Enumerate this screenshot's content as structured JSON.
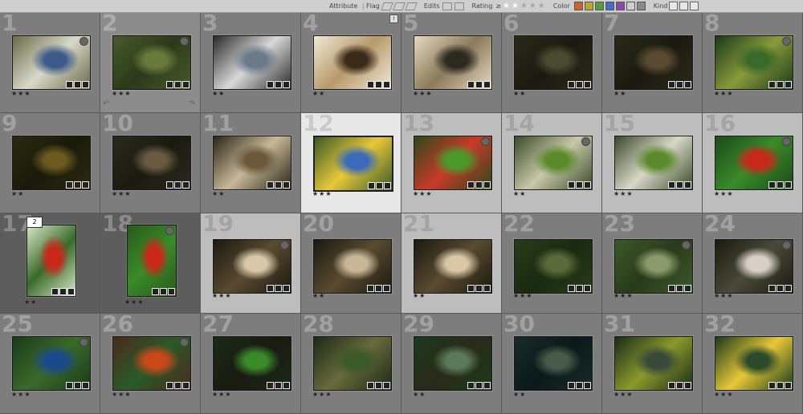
{
  "filter_bar": {
    "attribute_label": "Attribute",
    "flag_label": "Flag",
    "edits_label": "Edits",
    "rating_label": "Rating",
    "color_label": "Color",
    "kind_label": "Kind",
    "rating_compare": "≥",
    "color_swatches": [
      "#c86432",
      "#b8a830",
      "#5a9a3a",
      "#4a6ac8",
      "#8a4aa8",
      "#cfcfcf",
      "#8a8a8a"
    ]
  },
  "stack_count": "2",
  "photos": [
    {
      "n": "1",
      "rating": "★★★",
      "state": "normal"
    },
    {
      "n": "2",
      "rating": "★★★",
      "state": "hover"
    },
    {
      "n": "3",
      "rating": "★★",
      "state": "normal"
    },
    {
      "n": "4",
      "rating": "★★",
      "state": "normal"
    },
    {
      "n": "5",
      "rating": "★★★",
      "state": "normal"
    },
    {
      "n": "6",
      "rating": "★★",
      "state": "normal"
    },
    {
      "n": "7",
      "rating": "★★",
      "state": "normal"
    },
    {
      "n": "8",
      "rating": "★★★",
      "state": "normal"
    },
    {
      "n": "9",
      "rating": "★★",
      "state": "normal"
    },
    {
      "n": "10",
      "rating": "★★★",
      "state": "normal"
    },
    {
      "n": "11",
      "rating": "★★",
      "state": "normal"
    },
    {
      "n": "12",
      "rating": "★★★",
      "state": "primary"
    },
    {
      "n": "13",
      "rating": "★★★",
      "state": "selected"
    },
    {
      "n": "14",
      "rating": "★★",
      "state": "selected"
    },
    {
      "n": "15",
      "rating": "★★★",
      "state": "selected"
    },
    {
      "n": "16",
      "rating": "★★★",
      "state": "selected"
    },
    {
      "n": "17",
      "rating": "★★",
      "state": "stack"
    },
    {
      "n": "18",
      "rating": "★★★",
      "state": "stack"
    },
    {
      "n": "19",
      "rating": "★★★",
      "state": "selected"
    },
    {
      "n": "20",
      "rating": "★★",
      "state": "normal"
    },
    {
      "n": "21",
      "rating": "★★",
      "state": "selected"
    },
    {
      "n": "22",
      "rating": "★★★",
      "state": "normal"
    },
    {
      "n": "23",
      "rating": "★★★",
      "state": "normal"
    },
    {
      "n": "24",
      "rating": "★★★",
      "state": "normal"
    },
    {
      "n": "25",
      "rating": "★★★",
      "state": "normal"
    },
    {
      "n": "26",
      "rating": "★★★",
      "state": "normal"
    },
    {
      "n": "27",
      "rating": "★★★",
      "state": "normal"
    },
    {
      "n": "28",
      "rating": "★★★",
      "state": "normal"
    },
    {
      "n": "29",
      "rating": "★★",
      "state": "normal"
    },
    {
      "n": "30",
      "rating": "★★",
      "state": "normal"
    },
    {
      "n": "31",
      "rating": "★★★",
      "state": "normal"
    },
    {
      "n": "32",
      "rating": "★★★",
      "state": "normal"
    }
  ]
}
